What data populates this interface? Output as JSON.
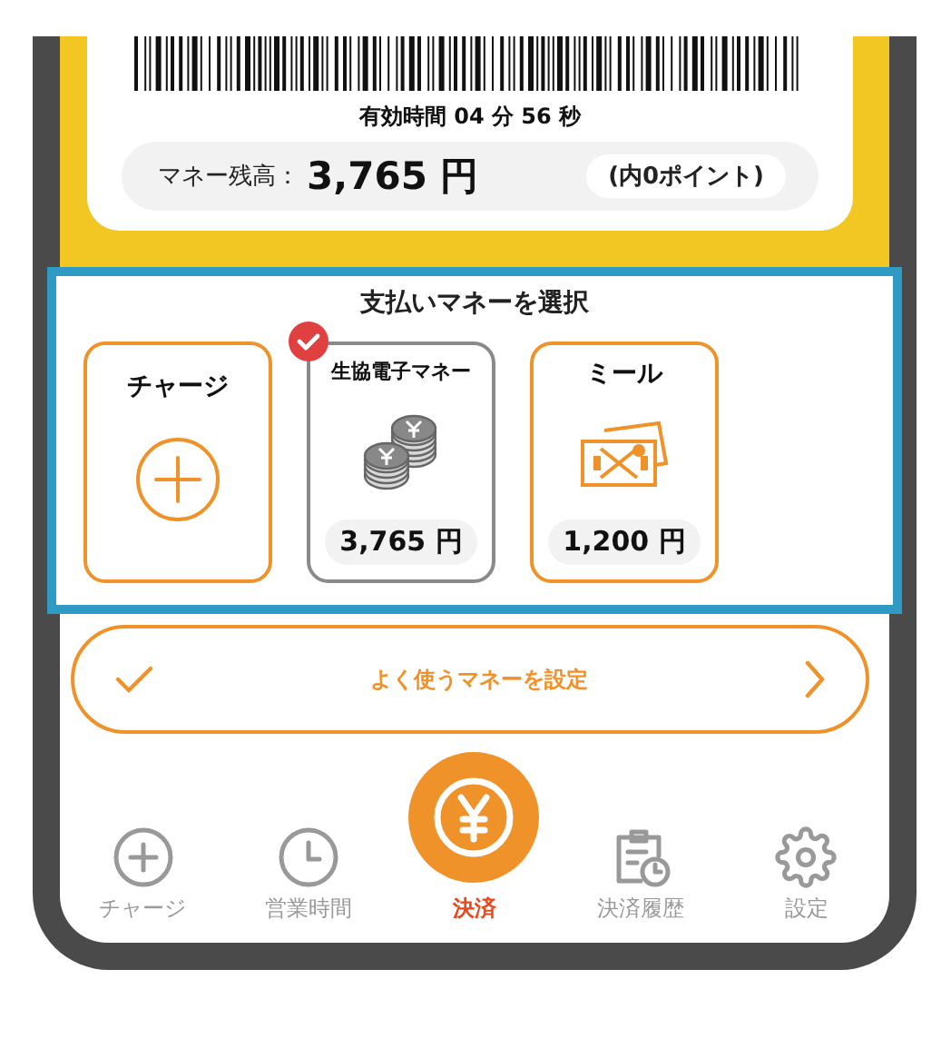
{
  "payment_code": {
    "expiry": "有効時間 04 分 56 秒",
    "balance_label": "マネー残高：",
    "balance": "3,765 円",
    "points": "(内0ポイント)"
  },
  "money_select": {
    "title": "支払いマネーを選択",
    "items": [
      {
        "kind": "charge",
        "label": "チャージ",
        "selected": false
      },
      {
        "kind": "coin",
        "label": "生協電子マネー",
        "amount": "3,765 円",
        "selected": true
      },
      {
        "kind": "meal",
        "label": "ミール",
        "amount": "1,200 円",
        "selected": false
      }
    ]
  },
  "favorite_button": {
    "label": "よく使うマネーを設定"
  },
  "tab_bar": [
    {
      "kind": "charge",
      "label": "チャージ",
      "selected": false
    },
    {
      "kind": "hours",
      "label": "営業時間",
      "selected": false
    },
    {
      "kind": "pay",
      "label": "決済",
      "selected": true
    },
    {
      "kind": "history",
      "label": "決済履歴",
      "selected": false
    },
    {
      "kind": "settings",
      "label": "設定",
      "selected": false
    }
  ]
}
